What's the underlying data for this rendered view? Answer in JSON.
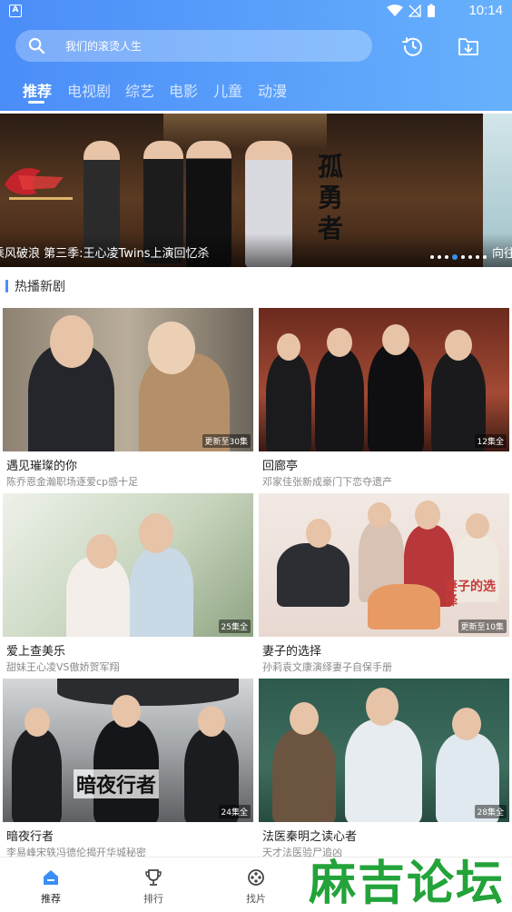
{
  "status_bar": {
    "time": "10:14",
    "app_badge": "A"
  },
  "search": {
    "placeholder": "我们的滚烫人生"
  },
  "tabs": [
    {
      "label": "推荐",
      "active": true
    },
    {
      "label": "电视剧",
      "active": false
    },
    {
      "label": "综艺",
      "active": false
    },
    {
      "label": "电影",
      "active": false
    },
    {
      "label": "儿童",
      "active": false
    },
    {
      "label": "动漫",
      "active": false
    }
  ],
  "banner": {
    "caption": "乘风破浪 第三季:王心凌Twins上演回忆杀",
    "next_caption": "向往",
    "calligraphy": "孤勇者",
    "page_count": 8,
    "active_page": 3
  },
  "section": {
    "title": "热播新剧"
  },
  "shows": [
    {
      "title": "遇见璀璨的你",
      "desc": "陈乔恩金瀚职场逐爱cp感十足",
      "badge": "更新至30集"
    },
    {
      "title": "回廊亭",
      "desc": "邓家佳张新成豪门下恋夺遗产",
      "badge": "12集全"
    },
    {
      "title": "爱上查美乐",
      "desc": "甜妹王心凌VS傲娇贺军翔",
      "badge": "25集全"
    },
    {
      "title": "妻子的选择",
      "desc": "孙莉袁文康演绎妻子自保手册",
      "badge": "更新至10集",
      "poster_text": "妻子的选择"
    },
    {
      "title": "暗夜行者",
      "desc": "李易峰宋轶冯德伦揭开华城秘密",
      "badge": "24集全",
      "poster_text": "暗夜行者"
    },
    {
      "title": "法医秦明之读心者",
      "desc": "天才法医验尸追凶",
      "badge": "28集全"
    }
  ],
  "bottom_nav": [
    {
      "label": "推荐",
      "icon": "home-icon",
      "active": true
    },
    {
      "label": "排行",
      "icon": "trophy-icon",
      "active": false
    },
    {
      "label": "找片",
      "icon": "film-reel-icon",
      "active": false
    }
  ],
  "watermark": "麻吉论坛",
  "colors": {
    "header_start": "#4b8df8",
    "header_end": "#67b1fc",
    "accent": "#3a8ef6",
    "watermark": "#23a339"
  }
}
